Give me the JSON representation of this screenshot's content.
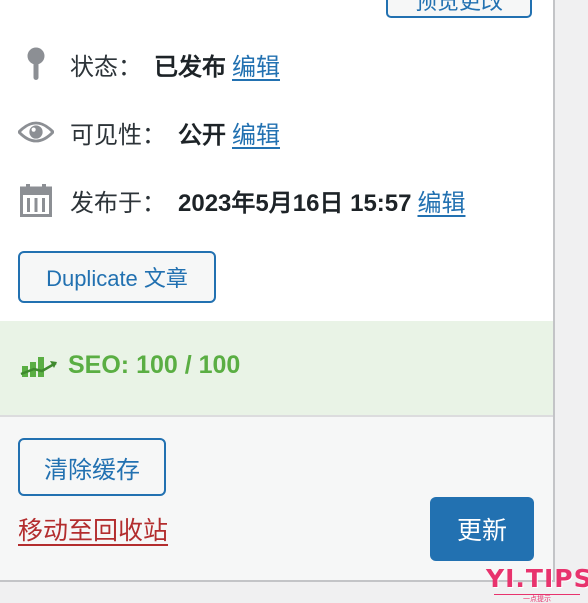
{
  "header": {
    "preview_label": "预览更改"
  },
  "publish": {
    "status": {
      "label": "状态：",
      "value": "已发布",
      "edit": "编辑"
    },
    "visibility": {
      "label": "可见性：",
      "value": "公开",
      "edit": "编辑"
    },
    "published_on": {
      "label": "发布于：",
      "value": "2023年5月16日 15:57",
      "edit": "编辑"
    },
    "duplicate_label": "Duplicate 文章"
  },
  "seo": {
    "text": "SEO: 100 / 100"
  },
  "actions": {
    "clear_cache_label": "清除缓存",
    "trash_label": "移动至回收站",
    "update_label": "更新"
  },
  "watermark": {
    "main": "YI.TIPS",
    "sub": "一点提示"
  },
  "colors": {
    "accent": "#2271b1",
    "seo_green": "#5aae43",
    "seo_bg": "#e9f3e6",
    "danger": "#b32d2e",
    "watermark": "#e8336d"
  },
  "icons": {
    "status": "pin-icon",
    "visibility": "eye-icon",
    "published_on": "calendar-icon",
    "seo": "seo-chart-icon"
  }
}
